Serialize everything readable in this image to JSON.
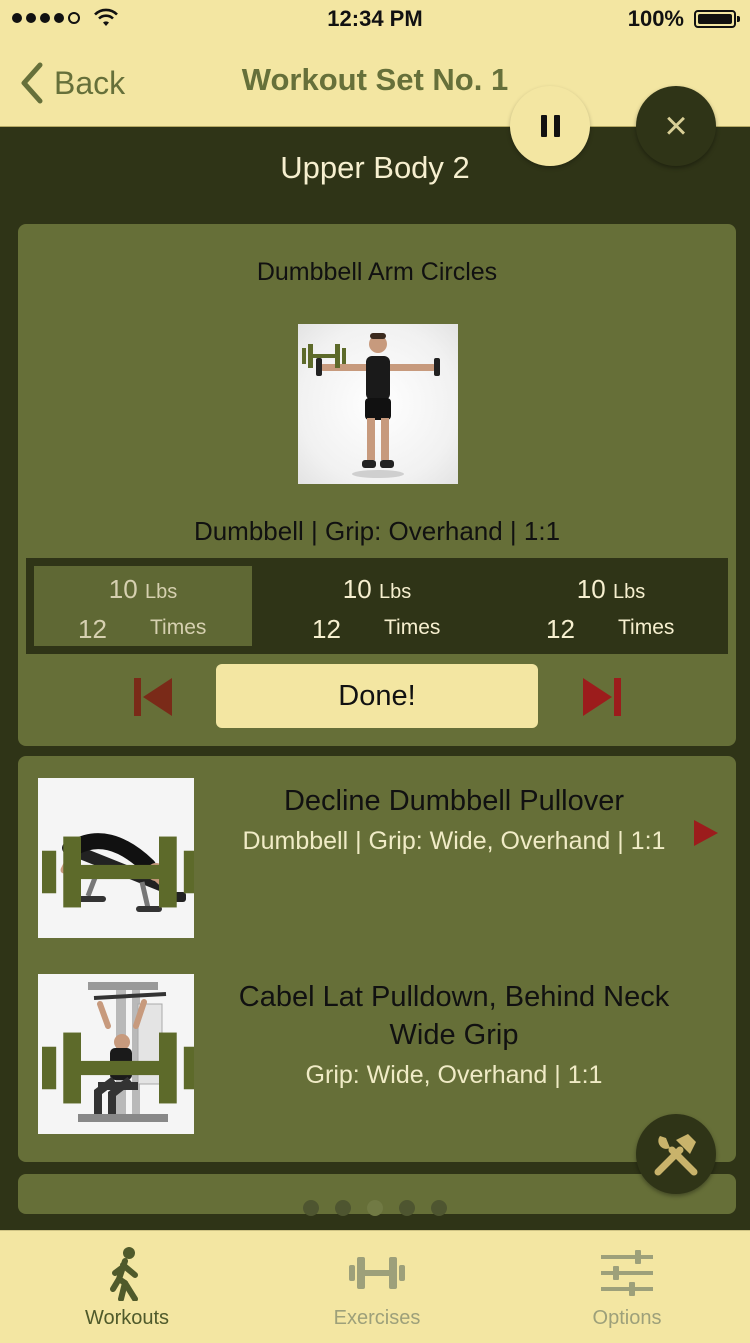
{
  "status_bar": {
    "time": "12:34 PM",
    "battery": "100%"
  },
  "nav": {
    "back_label": "Back",
    "title": "Workout Set No. 1"
  },
  "section": {
    "title": "Upper Body 2"
  },
  "current_exercise": {
    "name": "Dumbbell Arm Circles",
    "meta": "Dumbbell | Grip: Overhand | 1:1",
    "sets": [
      {
        "weight": "10",
        "unit": "Lbs",
        "reps": "12",
        "reps_label": "Times",
        "active": true
      },
      {
        "weight": "10",
        "unit": "Lbs",
        "reps": "12",
        "reps_label": "Times",
        "active": false
      },
      {
        "weight": "10",
        "unit": "Lbs",
        "reps": "12",
        "reps_label": "Times",
        "active": false
      }
    ],
    "done_label": "Done!"
  },
  "up_next": [
    {
      "title": "Decline Dumbbell Pullover",
      "meta": "Dumbbell | Grip: Wide, Overhand | 1:1"
    },
    {
      "title": "Cabel Lat Pulldown, Behind Neck Wide Grip",
      "meta": "Grip: Wide, Overhand | 1:1"
    }
  ],
  "pager": {
    "count": 5,
    "active_index": 2
  },
  "tabs": [
    {
      "label": "Workouts",
      "icon": "walking-person-icon",
      "active": true
    },
    {
      "label": "Exercises",
      "icon": "dumbbell-icon",
      "active": false
    },
    {
      "label": "Options",
      "icon": "sliders-icon",
      "active": false
    }
  ],
  "colors": {
    "accent_cream": "#f3e6a2",
    "olive": "#666f38",
    "dark_olive": "#2f3417",
    "danger_red": "#9c1c1c"
  }
}
